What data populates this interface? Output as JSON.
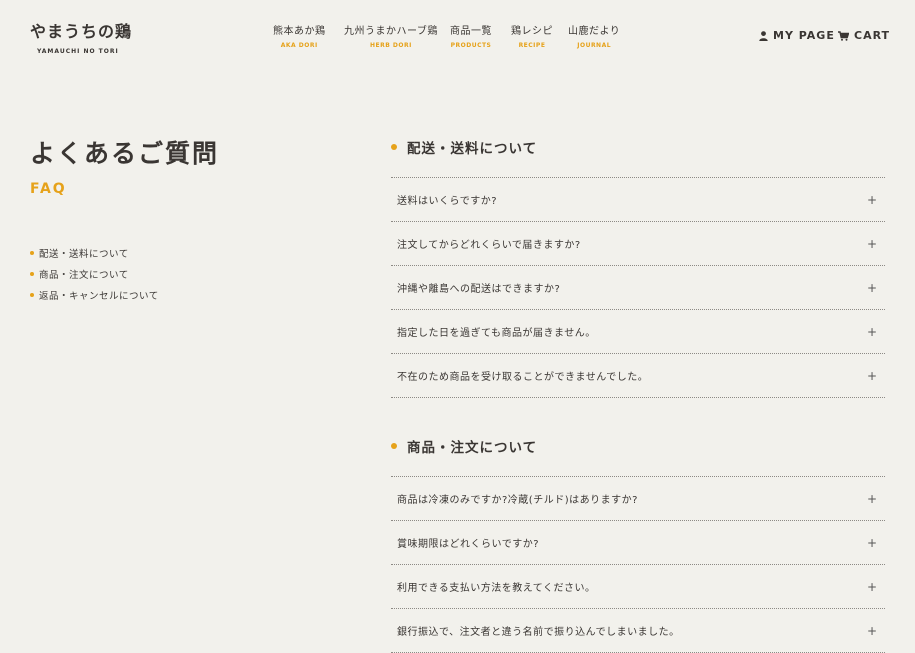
{
  "header": {
    "logo_jp": "やまうちの鶏",
    "logo_en": "YAMAUCHI NO TORI",
    "nav": [
      {
        "jp": "熊本あか鶏",
        "en": "AKA DORI"
      },
      {
        "jp": "九州うまかハーブ鶏",
        "en": "HERB DORI"
      },
      {
        "jp": "商品一覧",
        "en": "PRODUCTS"
      },
      {
        "jp": "鶏レシピ",
        "en": "RECIPE"
      },
      {
        "jp": "山鹿だより",
        "en": "JOURNAL"
      }
    ],
    "mypage": "MY PAGE",
    "cart": "CART"
  },
  "page": {
    "title": "よくあるご質問",
    "subtitle": "FAQ"
  },
  "sidebar": {
    "items": [
      "配送・送料について",
      "商品・注文について",
      "返品・キャンセルについて"
    ]
  },
  "sections": [
    {
      "title": "配送・送料について",
      "questions": [
        "送料はいくらですか?",
        "注文してからどれくらいで届きますか?",
        "沖縄や離島への配送はできますか?",
        "指定した日を過ぎても商品が届きません。",
        "不在のため商品を受け取ることができませんでした。"
      ]
    },
    {
      "title": "商品・注文について",
      "questions": [
        "商品は冷凍のみですか?冷蔵(チルド)はありますか?",
        "賞味期限はどれくらいですか?",
        "利用できる支払い方法を教えてください。",
        "銀行振込で、注文者と違う名前で振り込んでしまいました。"
      ]
    }
  ],
  "colors": {
    "accent": "#e6a21a",
    "background": "#f2f1ec",
    "text": "#3a3633"
  },
  "icons": {
    "expand": "plus-icon",
    "mypage": "user-icon",
    "cart": "cart-icon"
  }
}
